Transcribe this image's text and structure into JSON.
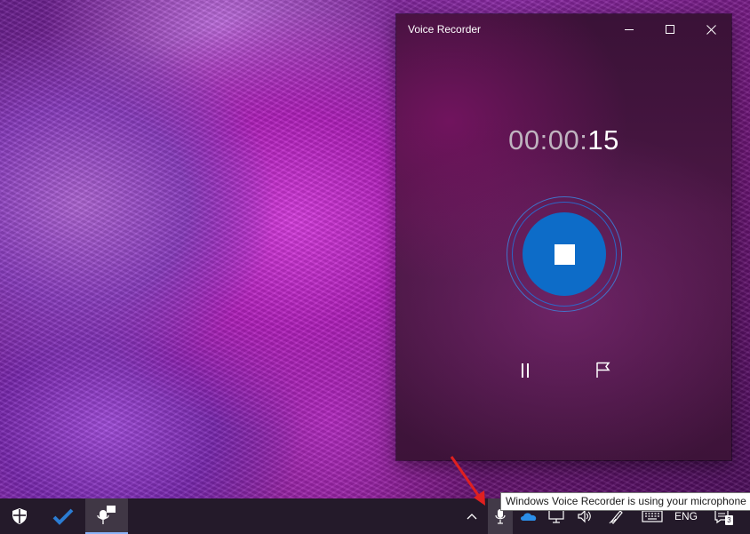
{
  "window": {
    "title": "Voice Recorder",
    "controls": {
      "minimize": "—",
      "maximize": "☐",
      "close": "✕"
    }
  },
  "recorder": {
    "timer_prefix": "00:00:",
    "timer_seconds": "15",
    "state": "recording",
    "buttons": [
      "stop-icon",
      "pause-icon",
      "flag-icon"
    ]
  },
  "taskbar": {
    "pinned_icons": [
      "shield-icon",
      "check-icon",
      "voice-recorder-icon"
    ],
    "tray_icons": [
      "chevron-up-icon",
      "microphone-icon",
      "onedrive-icon",
      "network-icon",
      "volume-icon",
      "pen-icon",
      "keyboard-icon"
    ],
    "language": "ENG",
    "notifications_badge": "3"
  },
  "tooltip": {
    "text": "Windows Voice Recorder is using your microphone"
  },
  "colors": {
    "accent": "#0d6cc8",
    "window_bg": "#4a1744",
    "taskbar_bg": "#241a2a",
    "annotation_arrow": "#e02020"
  }
}
